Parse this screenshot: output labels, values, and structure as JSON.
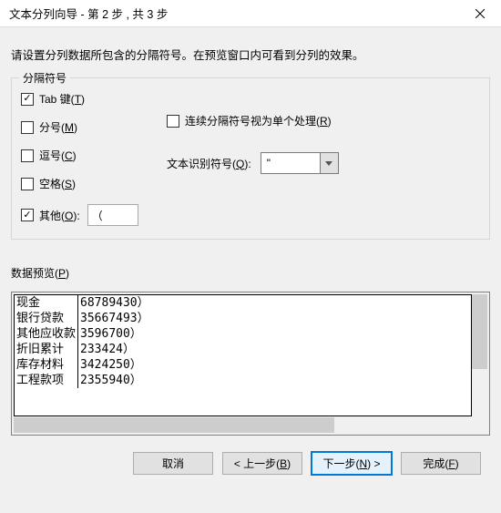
{
  "titlebar": {
    "title": "文本分列向导 - 第 2 步 , 共 3 步"
  },
  "instruction": "请设置分列数据所包含的分隔符号。在预览窗口内可看到分列的效果。",
  "delimiters": {
    "legend": "分隔符号",
    "tab": {
      "label_pre": "Tab 键(",
      "mnemonic": "T",
      "label_post": ")",
      "checked": true
    },
    "semicolon": {
      "label_pre": "分号(",
      "mnemonic": "M",
      "label_post": ")",
      "checked": false
    },
    "comma": {
      "label_pre": "逗号(",
      "mnemonic": "C",
      "label_post": ")",
      "checked": false
    },
    "space": {
      "label_pre": "空格(",
      "mnemonic": "S",
      "label_post": ")",
      "checked": false
    },
    "other": {
      "label_pre": "其他(",
      "mnemonic": "O",
      "label_post": "):",
      "checked": true,
      "value": "（"
    },
    "consecutive": {
      "label_pre": "连续分隔符号视为单个处理(",
      "mnemonic": "R",
      "label_post": ")",
      "checked": false
    },
    "qualifier_label_pre": "文本识别符号(",
    "qualifier_mnemonic": "Q",
    "qualifier_label_post": "):",
    "qualifier_value": "\""
  },
  "preview": {
    "label_pre": "数据预览(",
    "mnemonic": "P",
    "label_post": ")",
    "rows": [
      {
        "c1": "现金",
        "c2": "68789430）"
      },
      {
        "c1": "银行贷款",
        "c2": "35667493）"
      },
      {
        "c1": "其他应收款",
        "c2": "3596700）"
      },
      {
        "c1": "折旧累计",
        "c2": "233424）"
      },
      {
        "c1": "库存材料",
        "c2": "3424250）"
      },
      {
        "c1": "工程款项",
        "c2": "2355940）"
      }
    ]
  },
  "buttons": {
    "cancel": "取消",
    "back_pre": "< 上一步(",
    "back_mn": "B",
    "back_post": ")",
    "next_pre": "下一步(",
    "next_mn": "N",
    "next_post": ") >",
    "finish_pre": "完成(",
    "finish_mn": "F",
    "finish_post": ")"
  }
}
